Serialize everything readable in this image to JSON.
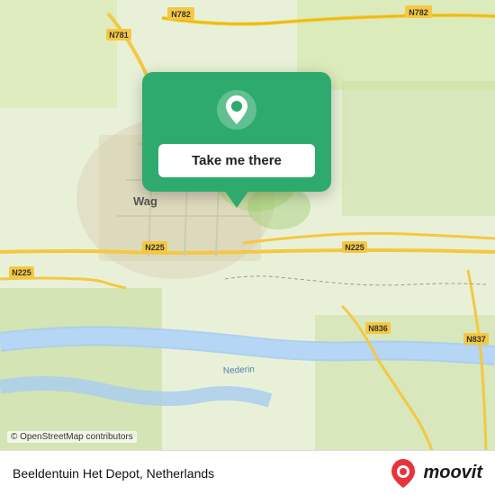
{
  "map": {
    "attribution": "© OpenStreetMap contributors",
    "center_label": "Wageningen"
  },
  "popup": {
    "button_label": "Take me there"
  },
  "footer": {
    "location": "Beeldentuin Het Depot, Netherlands",
    "logo_text": "moovit"
  },
  "road_labels": {
    "n782_top_left": "N782",
    "n782_top_right": "N782",
    "n781": "N781",
    "n225_left": "N225",
    "n225_mid": "N225",
    "n225_right": "N225",
    "n836": "N836",
    "n837": "N837",
    "nederin": "Nederin",
    "wageningen": "Wag..."
  }
}
